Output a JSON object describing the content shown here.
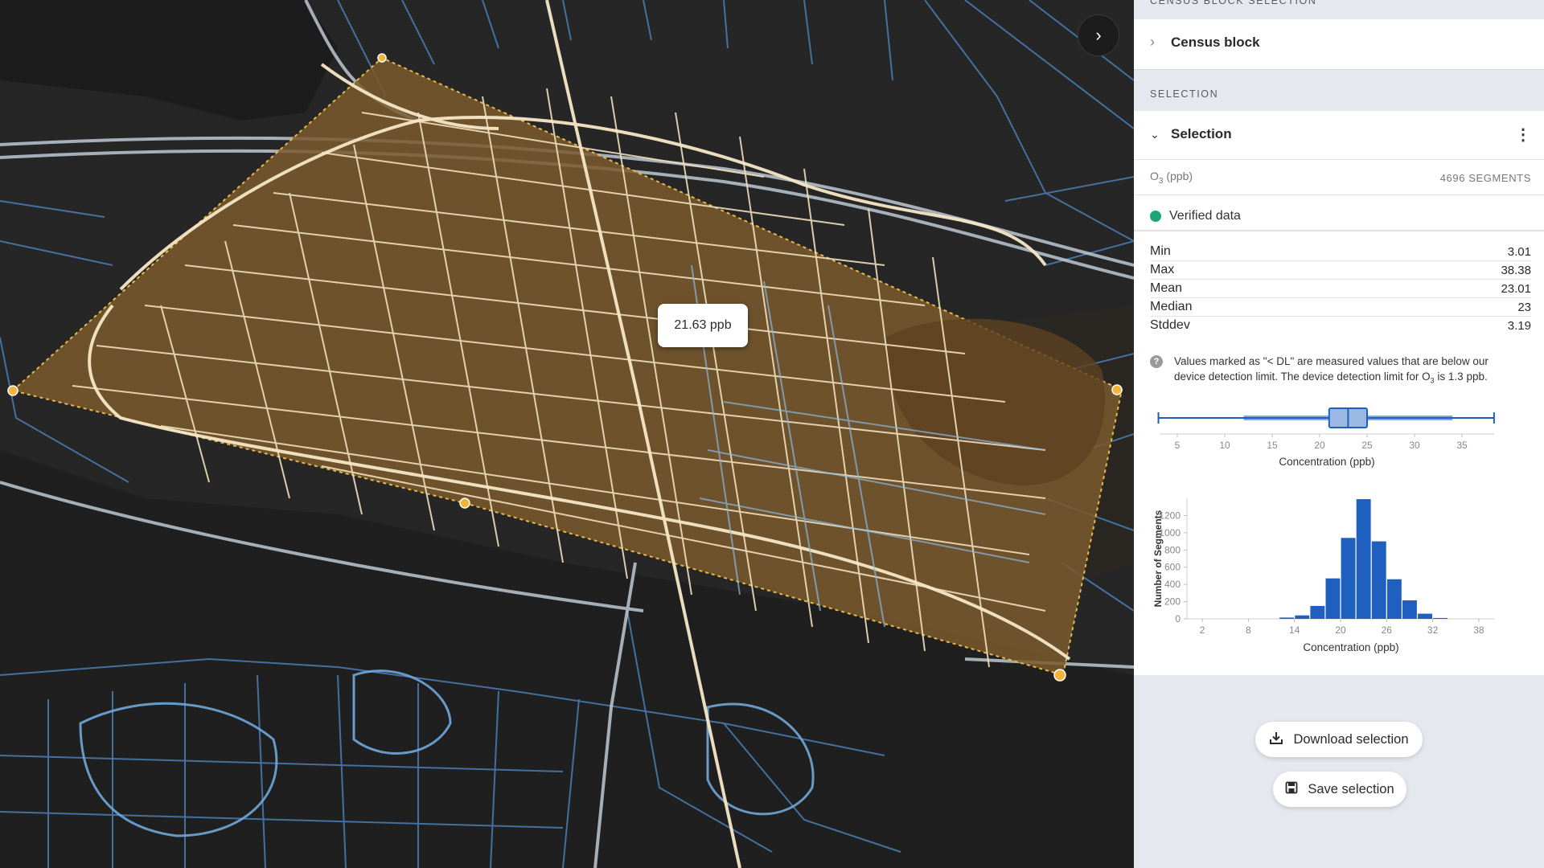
{
  "map": {
    "tooltip_value": "21.63 ppb",
    "collapse_icon": "chevron-right-icon"
  },
  "panel": {
    "census_section_header": "CENSUS BLOCK SELECTION",
    "census_item_label": "Census block",
    "selection_section_header": "SELECTION",
    "selection_title": "Selection",
    "pollutant_prefix": "O",
    "pollutant_subscript": "3",
    "pollutant_suffix": " (ppb)",
    "segments_count": "4696 SEGMENTS",
    "verified_label": "Verified data",
    "verified_color": "#1fa37a",
    "stats": [
      {
        "label": "Min",
        "value": "3.01"
      },
      {
        "label": "Max",
        "value": "38.38"
      },
      {
        "label": "Mean",
        "value": "23.01"
      },
      {
        "label": "Median",
        "value": "23"
      },
      {
        "label": "Stddev",
        "value": "3.19"
      }
    ],
    "note_line1": "Values marked as \"< DL\" are measured values that are below our",
    "note_line2_prefix": "device detection limit. The device detection limit for O",
    "note_line2_sub": "3",
    "note_line2_suffix": " is 1.3 ppb.",
    "download_label": "Download selection",
    "save_label": "Save selection"
  },
  "chart_data": [
    {
      "type": "boxplot",
      "xlabel": "Concentration (ppb)",
      "xticks": [
        5,
        10,
        15,
        20,
        25,
        30,
        35
      ],
      "xlim": [
        3.01,
        38.38
      ],
      "min": 3.01,
      "q1": 21,
      "median": 23,
      "q3": 25,
      "max": 38.38,
      "color": "#1f5fbf"
    },
    {
      "type": "bar",
      "xlabel": "Concentration (ppb)",
      "ylabel": "Number of Segments",
      "xticks": [
        2,
        8,
        14,
        20,
        26,
        32,
        38
      ],
      "yticks": [
        0,
        200,
        400,
        600,
        800,
        1000,
        1200
      ],
      "xlim": [
        0,
        40
      ],
      "ylim": [
        0,
        1400
      ],
      "bin_width": 2,
      "bins": [
        {
          "x0": 12,
          "value": 15
        },
        {
          "x0": 14,
          "value": 40
        },
        {
          "x0": 16,
          "value": 150
        },
        {
          "x0": 18,
          "value": 470
        },
        {
          "x0": 20,
          "value": 940
        },
        {
          "x0": 22,
          "value": 1390
        },
        {
          "x0": 24,
          "value": 900
        },
        {
          "x0": 26,
          "value": 460
        },
        {
          "x0": 28,
          "value": 215
        },
        {
          "x0": 30,
          "value": 60
        },
        {
          "x0": 32,
          "value": 10
        }
      ],
      "color": "#1f5fbf"
    }
  ]
}
